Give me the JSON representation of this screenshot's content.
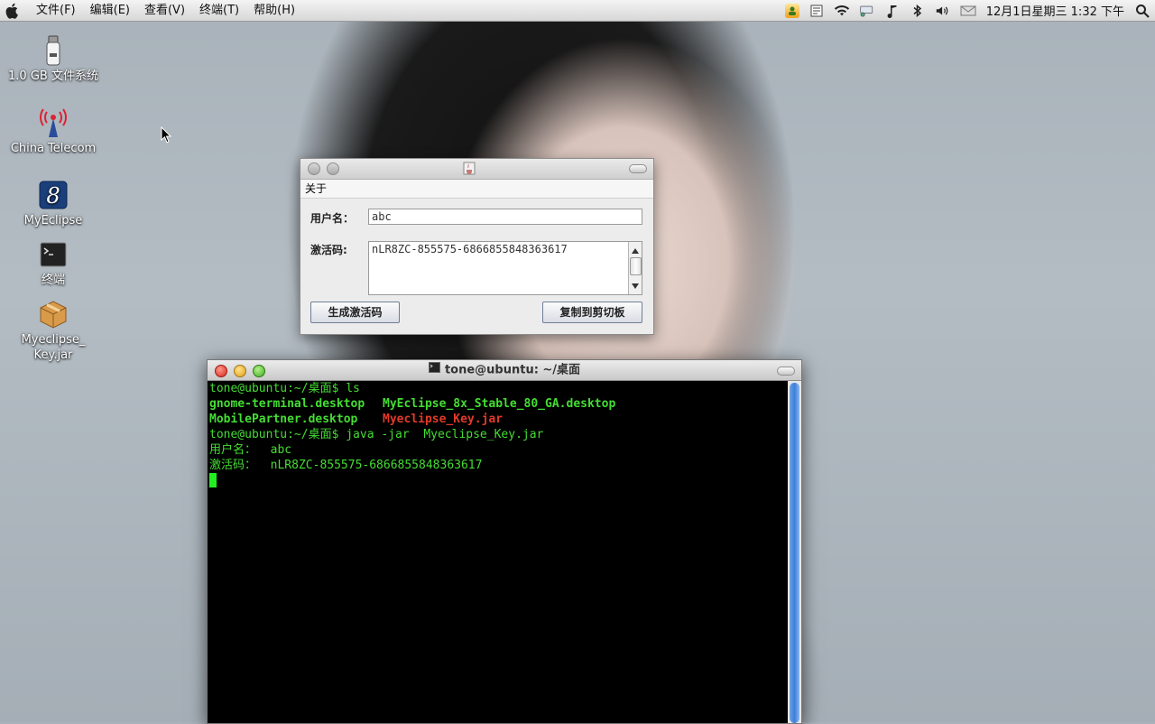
{
  "menubar": {
    "items": [
      "文件(F)",
      "编辑(E)",
      "查看(V)",
      "终端(T)",
      "帮助(H)"
    ],
    "datetime": "12月1日星期三  1:32 下午"
  },
  "desktop": {
    "icons": [
      {
        "label": "1.0 GB 文件系统",
        "icon": "usb-drive-icon"
      },
      {
        "label": "China Telecom",
        "icon": "antenna-icon"
      },
      {
        "label": "MyEclipse",
        "icon": "myeclipse-icon"
      },
      {
        "label": "终端",
        "icon": "terminal-icon"
      },
      {
        "label": "Myeclipse_ Key.jar",
        "icon": "jar-package-icon"
      }
    ]
  },
  "dialog": {
    "menu": "关于",
    "username_label": "用户名：",
    "username_value": "abc",
    "activation_label": "激活码:",
    "activation_value": "nLR8ZC-855575-6866855848363617",
    "generate_button": "生成激活码",
    "copy_button": "复制到剪切板"
  },
  "terminal": {
    "title": "tone@ubuntu: ~/桌面",
    "prompt1": "tone@ubuntu:~/桌面$ ls",
    "ls_row1_a": "gnome-terminal.desktop",
    "ls_row1_b": "MyEclipse_8x_Stable_80_GA.desktop",
    "ls_row2_a": "MobilePartner.desktop",
    "ls_row2_b": "Myeclipse_Key.jar",
    "prompt2": "tone@ubuntu:~/桌面$ java -jar  Myeclipse_Key.jar",
    "out_user": "用户名：  abc",
    "out_code": "激活码：  nLR8ZC-855575-6866855848363617"
  }
}
